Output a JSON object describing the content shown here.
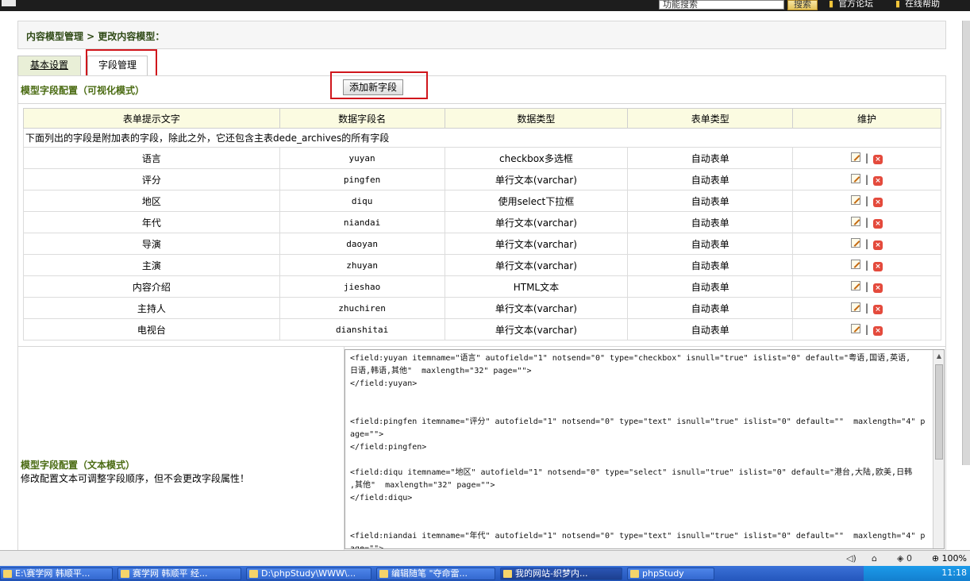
{
  "topbar": {
    "search_placeholder": "功能搜索",
    "search_button": "搜索",
    "links": [
      "官方论坛",
      "在线帮助"
    ]
  },
  "breadcrumb": {
    "text": "内容模型管理 > 更改内容模型："
  },
  "tabs": [
    {
      "label": "基本设置",
      "active": false
    },
    {
      "label": "字段管理",
      "active": true
    }
  ],
  "visual_section": {
    "title": "模型字段配置（可视化模式）",
    "add_button": "添加新字段"
  },
  "table": {
    "headers": [
      "表单提示文字",
      "数据字段名",
      "数据类型",
      "表单类型",
      "维护"
    ],
    "note": "下面列出的字段是附加表的字段，除此之外，它还包含主表dede_archives的所有字段",
    "rows": [
      [
        "语言",
        "yuyan",
        "checkbox多选框",
        "自动表单"
      ],
      [
        "评分",
        "pingfen",
        "单行文本(varchar)",
        "自动表单"
      ],
      [
        "地区",
        "diqu",
        "使用select下拉框",
        "自动表单"
      ],
      [
        "年代",
        "niandai",
        "单行文本(varchar)",
        "自动表单"
      ],
      [
        "导演",
        "daoyan",
        "单行文本(varchar)",
        "自动表单"
      ],
      [
        "主演",
        "zhuyan",
        "单行文本(varchar)",
        "自动表单"
      ],
      [
        "内容介绍",
        "jieshao",
        "HTML文本",
        "自动表单"
      ],
      [
        "主持人",
        "zhuchiren",
        "单行文本(varchar)",
        "自动表单"
      ],
      [
        "电视台",
        "dianshitai",
        "单行文本(varchar)",
        "自动表单"
      ]
    ],
    "action_separator": "|"
  },
  "text_section": {
    "title": "模型字段配置（文本模式）",
    "description": "修改配置文本可调整字段顺序，但不会更改字段属性！",
    "code": "<field:yuyan itemname=\"语言\" autofield=\"1\" notsend=\"0\" type=\"checkbox\" isnull=\"true\" islist=\"0\" default=\"粤语,国语,英语,\n日语,韩语,其他\"  maxlength=\"32\" page=\"\">\n</field:yuyan>\n\n\n<field:pingfen itemname=\"评分\" autofield=\"1\" notsend=\"0\" type=\"text\" isnull=\"true\" islist=\"0\" default=\"\"  maxlength=\"4\" p\nage=\"\">\n</field:pingfen>\n\n<field:diqu itemname=\"地区\" autofield=\"1\" notsend=\"0\" type=\"select\" isnull=\"true\" islist=\"0\" default=\"港台,大陆,欧美,日韩\n,其他\"  maxlength=\"32\" page=\"\">\n</field:diqu>\n\n\n<field:niandai itemname=\"年代\" autofield=\"1\" notsend=\"0\" type=\"text\" isnull=\"true\" islist=\"0\" default=\"\"  maxlength=\"4\" p\nage=\"\">"
  },
  "statusbar": {
    "zoom": "100%",
    "counter": "0"
  },
  "taskbar": {
    "tasks": [
      {
        "label": "E:\\赛学网 韩顺平...",
        "active": false
      },
      {
        "label": "赛学网 韩顺平 经...",
        "active": false
      },
      {
        "label": "D:\\phpStudy\\WWW\\...",
        "active": false
      },
      {
        "label": "编辑随笔 \"夺命雷...",
        "active": false
      },
      {
        "label": "我的网站-织梦内...",
        "active": true
      },
      {
        "label": "phpStudy",
        "active": false
      }
    ],
    "clock": "11:18"
  }
}
